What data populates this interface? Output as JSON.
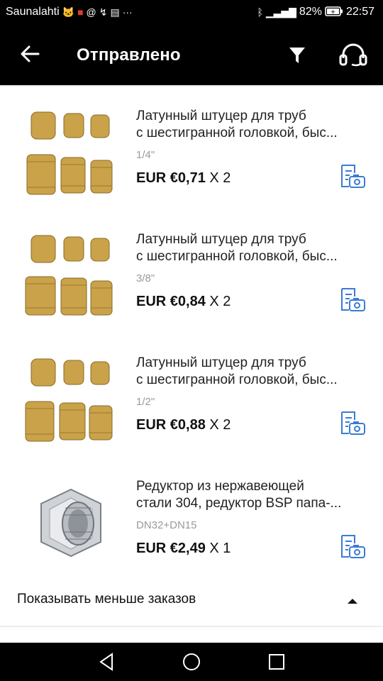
{
  "status_bar": {
    "carrier": "Saunalahti",
    "battery": "82%",
    "time": "22:57",
    "icons": [
      "cat-icon",
      "gift-icon",
      "at-icon",
      "missed-call-icon",
      "storage-icon",
      "more-icon",
      "bluetooth-icon",
      "4g-signal-icon",
      "battery-icon"
    ]
  },
  "header": {
    "title": "Отправлено",
    "icons": [
      "back-arrow-icon",
      "filter-icon",
      "headset-icon"
    ]
  },
  "orders": [
    {
      "name_line1": "Латунный штуцер для труб",
      "name_line2": "с шестигранной головкой, быс...",
      "variant": "1/4\"",
      "price": "EUR €0,71",
      "qty": "X 2"
    },
    {
      "name_line1": "Латунный штуцер для труб",
      "name_line2": "с шестигранной головкой, быс...",
      "variant": "3/8\"",
      "price": "EUR €0,84",
      "qty": "X 2"
    },
    {
      "name_line1": "Латунный штуцер для труб",
      "name_line2": "с шестигранной головкой, быс...",
      "variant": "1/2\"",
      "price": "EUR €0,88",
      "qty": "X 2"
    },
    {
      "name_line1": "Редуктор из нержавеющей",
      "name_line2": "стали 304, редуктор BSP папа-...",
      "variant": "DN32+DN15",
      "price": "EUR €2,49",
      "qty": "X 1"
    }
  ],
  "show_less": {
    "label": "Показывать меньше заказов"
  },
  "colors": {
    "bar": "#000000",
    "accent_icon": "#3a7bd5",
    "muted_text": "#9a9a9a",
    "brass": "#c9a24a"
  },
  "nav_bar": {
    "icons": [
      "back-triangle-icon",
      "home-circle-icon",
      "recents-square-icon"
    ]
  }
}
